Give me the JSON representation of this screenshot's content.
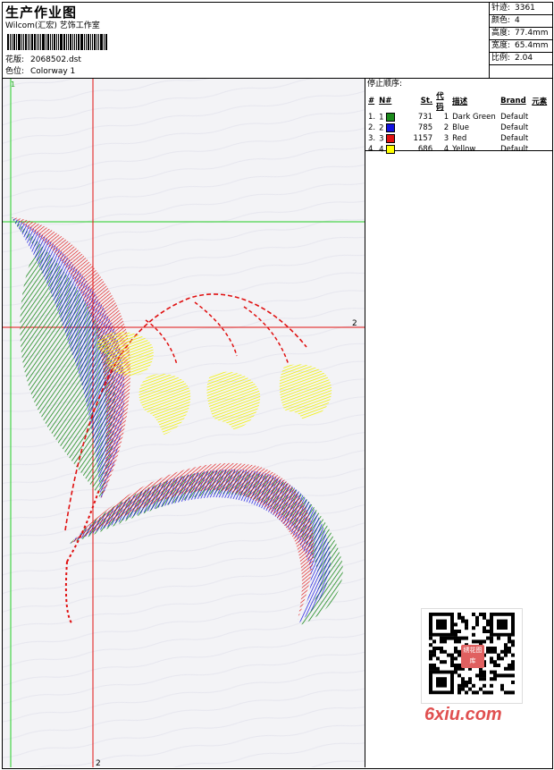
{
  "header": {
    "title": "生产作业图",
    "company": "Wilcom(汇宏) 艺饰工作室",
    "design_label": "花版:",
    "design_value": "2068502.dst",
    "colorway_label": "色位:",
    "colorway_value": "Colorway 1"
  },
  "stats": [
    {
      "label": "针迹:",
      "value": "3361"
    },
    {
      "label": "颜色:",
      "value": "4"
    },
    {
      "label": "高度:",
      "value": "77.4mm"
    },
    {
      "label": "宽度:",
      "value": "65.4mm"
    },
    {
      "label": "比例:",
      "value": "2.04"
    }
  ],
  "stop_sequence": {
    "title": "停止顺序:",
    "headers": [
      "#",
      "N#",
      "St.",
      "代码",
      "描述",
      "Brand",
      "元素"
    ],
    "rows": [
      {
        "num": "1.",
        "n": "1",
        "color": "#1a8a1a",
        "st": "731",
        "code": "1",
        "desc": "Dark Green",
        "brand": "Default"
      },
      {
        "num": "2.",
        "n": "2",
        "color": "#1010e0",
        "st": "785",
        "code": "2",
        "desc": "Blue",
        "brand": "Default"
      },
      {
        "num": "3.",
        "n": "3",
        "color": "#e01010",
        "st": "1157",
        "code": "3",
        "desc": "Red",
        "brand": "Default"
      },
      {
        "num": "4.",
        "n": "4",
        "color": "#ffff00",
        "st": "686",
        "code": "4",
        "desc": "Yellow",
        "brand": "Default"
      }
    ]
  },
  "design": {
    "axis_h_label": "2",
    "axis_v_label": "2",
    "origin_label": "1",
    "guide_color": "#e01010",
    "start_color": "#22cc22"
  },
  "watermark": {
    "site": "6xiu.com",
    "stamp": "绣花图库"
  }
}
